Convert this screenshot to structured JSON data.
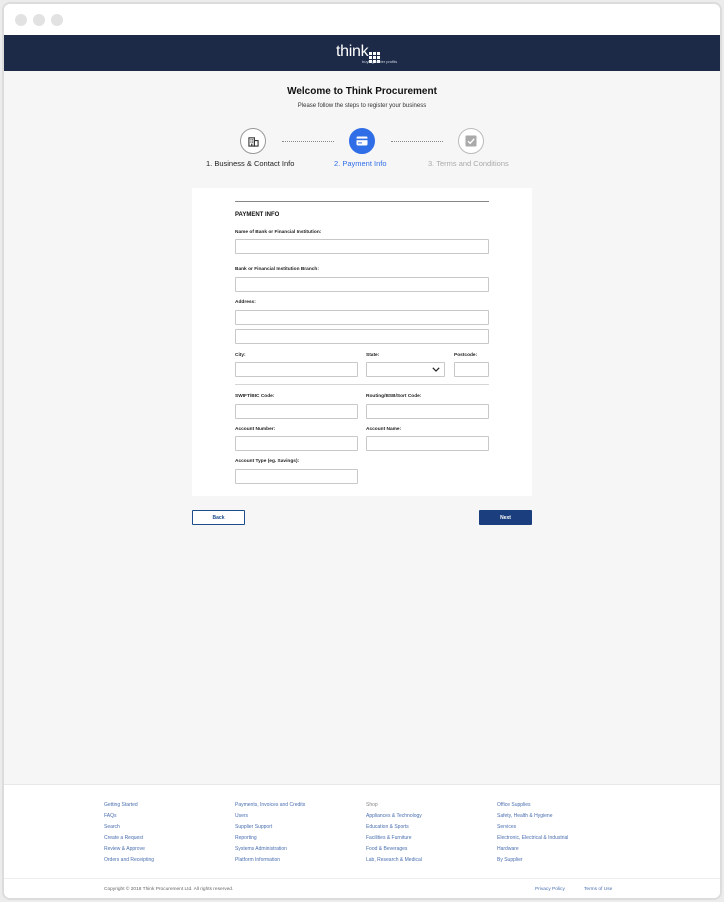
{
  "header": {
    "logo_text": "think",
    "tagline": "buying better profits"
  },
  "page": {
    "title": "Welcome to Think Procurement",
    "subtitle": "Please follow the steps to register your business"
  },
  "steps": [
    {
      "label": "1. Business & Contact Info",
      "icon": "building-icon",
      "state": "done"
    },
    {
      "label": "2. Payment Info",
      "icon": "credit-card-icon",
      "state": "active"
    },
    {
      "label": "3. Terms and Conditions",
      "icon": "checkbox-icon",
      "state": "pending"
    }
  ],
  "form": {
    "section_title": "PAYMENT INFO",
    "bank_name_label": "Name of Bank or Financial Institution:",
    "bank_branch_label": "Bank or Financial Institution Branch:",
    "address_label": "Address:",
    "city_label": "City:",
    "state_label": "State:",
    "postcode_label": "Postcode:",
    "swift_label": "SWIFT/BIC Code:",
    "routing_label": "Routing/BSB/Sort Code:",
    "account_number_label": "Account Number:",
    "account_name_label": "Account Name:",
    "account_type_label": "Account Type (eg. Savings):"
  },
  "actions": {
    "back": "Back",
    "next": "Next"
  },
  "footer": {
    "col1": [
      "Getting Started",
      "FAQs",
      "Search",
      "Create a Request",
      "Review & Approve",
      "Orders and Receipting"
    ],
    "col2": [
      "Payments, Invoices and Credits",
      "Users",
      "Supplier Support",
      "Reporting",
      "Systems Administration",
      "Platform Information"
    ],
    "col3": [
      "Shop",
      "Appliances & Technology",
      "Education & Sports",
      "Facilities & Furniture",
      "Food & Beverages",
      "Lab, Research & Medical"
    ],
    "col4": [
      "Office Supplies",
      "Safety, Health & Hygiene",
      "Services",
      "Electronic, Electrical & Industrial",
      "Hardware",
      "By Supplier"
    ],
    "copyright": "Copyright © 2018 Think Procurement Ltd. All rights reserved.",
    "privacy": "Privacy Policy",
    "terms": "Terms of Use"
  },
  "colors": {
    "brand": "#1c2a47",
    "accent": "#2f6ee6",
    "button": "#1b3f7e"
  }
}
